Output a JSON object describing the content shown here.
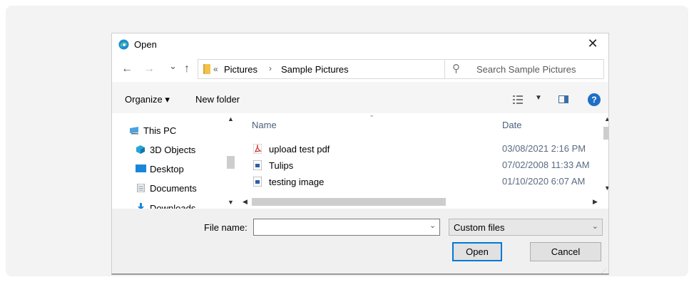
{
  "window": {
    "title": "Open",
    "close_glyph": "✕"
  },
  "nav": {
    "back_glyph": "←",
    "forward_glyph": "→",
    "recent_glyph": "⌄",
    "up_glyph": "↑",
    "breadcrumb_sep_start": "«",
    "breadcrumb": [
      "Pictures",
      "Sample Pictures"
    ],
    "breadcrumb_sep": "›",
    "address_dropdown_glyph": "⌄",
    "refresh_glyph": "↻",
    "search_placeholder": "Search Sample Pictures",
    "search_glyph": "⚲"
  },
  "toolbar": {
    "organize_label": "Organize ▾",
    "new_folder_label": "New folder",
    "view_dropdown_glyph": "▼",
    "help_glyph": "?"
  },
  "sidebar": {
    "items": [
      {
        "label": "This PC",
        "icon": "this-pc-icon"
      },
      {
        "label": "3D Objects",
        "icon": "3d-objects-icon"
      },
      {
        "label": "Desktop",
        "icon": "desktop-icon"
      },
      {
        "label": "Documents",
        "icon": "documents-icon"
      },
      {
        "label": "Downloads",
        "icon": "downloads-icon"
      }
    ]
  },
  "files": {
    "columns": {
      "name": "Name",
      "date": "Date"
    },
    "rows": [
      {
        "name": "upload test pdf",
        "date": "03/08/2021 2:16 PM",
        "icon": "pdf-file-icon"
      },
      {
        "name": "Tulips",
        "date": "07/02/2008 11:33 AM",
        "icon": "image-file-icon"
      },
      {
        "name": "testing image",
        "date": "01/10/2020 6:07 AM",
        "icon": "image-file-icon"
      }
    ]
  },
  "bottom": {
    "file_name_label": "File name:",
    "file_name_value": "",
    "file_type_value": "Custom files",
    "open_label": "Open",
    "cancel_label": "Cancel"
  },
  "colors": {
    "accent": "#0078d7",
    "dialog_bg": "#ffffff",
    "footer_bg": "#f0f0f0"
  }
}
